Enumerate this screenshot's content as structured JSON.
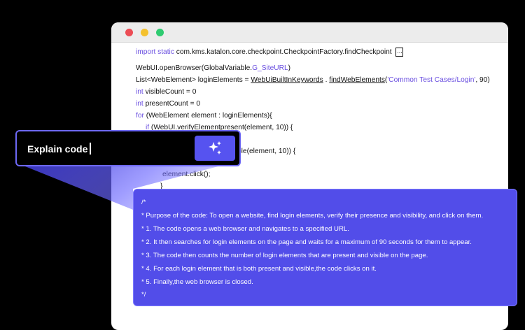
{
  "window": {
    "controls": [
      "close",
      "minimize",
      "maximize"
    ],
    "colors": {
      "close": "#ec4d55",
      "minimize": "#f4c12e",
      "maximize": "#2fcb71"
    }
  },
  "code": {
    "l1": {
      "kw": "import static",
      "text": " com.kms.katalon.core.checkpoint.CheckpointFactory.findCheckpoint",
      "fold": "..."
    },
    "l2": {
      "a": "WebUI.openBrowser(GlobalVariable.",
      "ref": "G_SiteURL",
      "b": ")"
    },
    "l3": {
      "a": "List<WebElement> loginElements = ",
      "u1": "WebUiBuiltInKeywords",
      "dot": " . ",
      "u2": "findWebElements",
      "b": "(",
      "str": "'Common Test Cases/Login'",
      "c": ", 90)"
    },
    "l4": {
      "kw": "int",
      "text": " visibleCount = 0"
    },
    "l5": {
      "kw": "int",
      "text": " presentCount = 0"
    },
    "l6": {
      "kw": "for",
      "text": " (WebElement element : loginElements){"
    },
    "l7": {
      "kw": "if",
      "text": " (WebUI.verifyElementpresent(element, 10)) {"
    },
    "l8": {
      "text": "ble(element, 10)) {"
    },
    "l9": {
      "text": "element.click();"
    },
    "l10": {
      "text": "}"
    }
  },
  "prompt": {
    "text": "Explain code",
    "button_icon": "sparkles-icon"
  },
  "explanation": {
    "lines": [
      "/*",
      "* Purpose of the code: To open a website, find login elements, verify their presence and visibility, and click on them.",
      "* 1. The code opens a web browser and navigates to a specified URL.",
      "* 2. It then searches for login elements on the page and waits for a maximum of 90 seconds for them to appear.",
      "* 3. The code then counts the number of login elements that are present and visible on the page.",
      "* 4. For each login element that is both present and visible,the code clicks on it.",
      "* 5. Finally,the web browser is closed.",
      "*/"
    ]
  },
  "colors": {
    "accent": "#5653f0",
    "panel": "#524de9",
    "keyword": "#6a4fe0",
    "background": "#000000"
  }
}
